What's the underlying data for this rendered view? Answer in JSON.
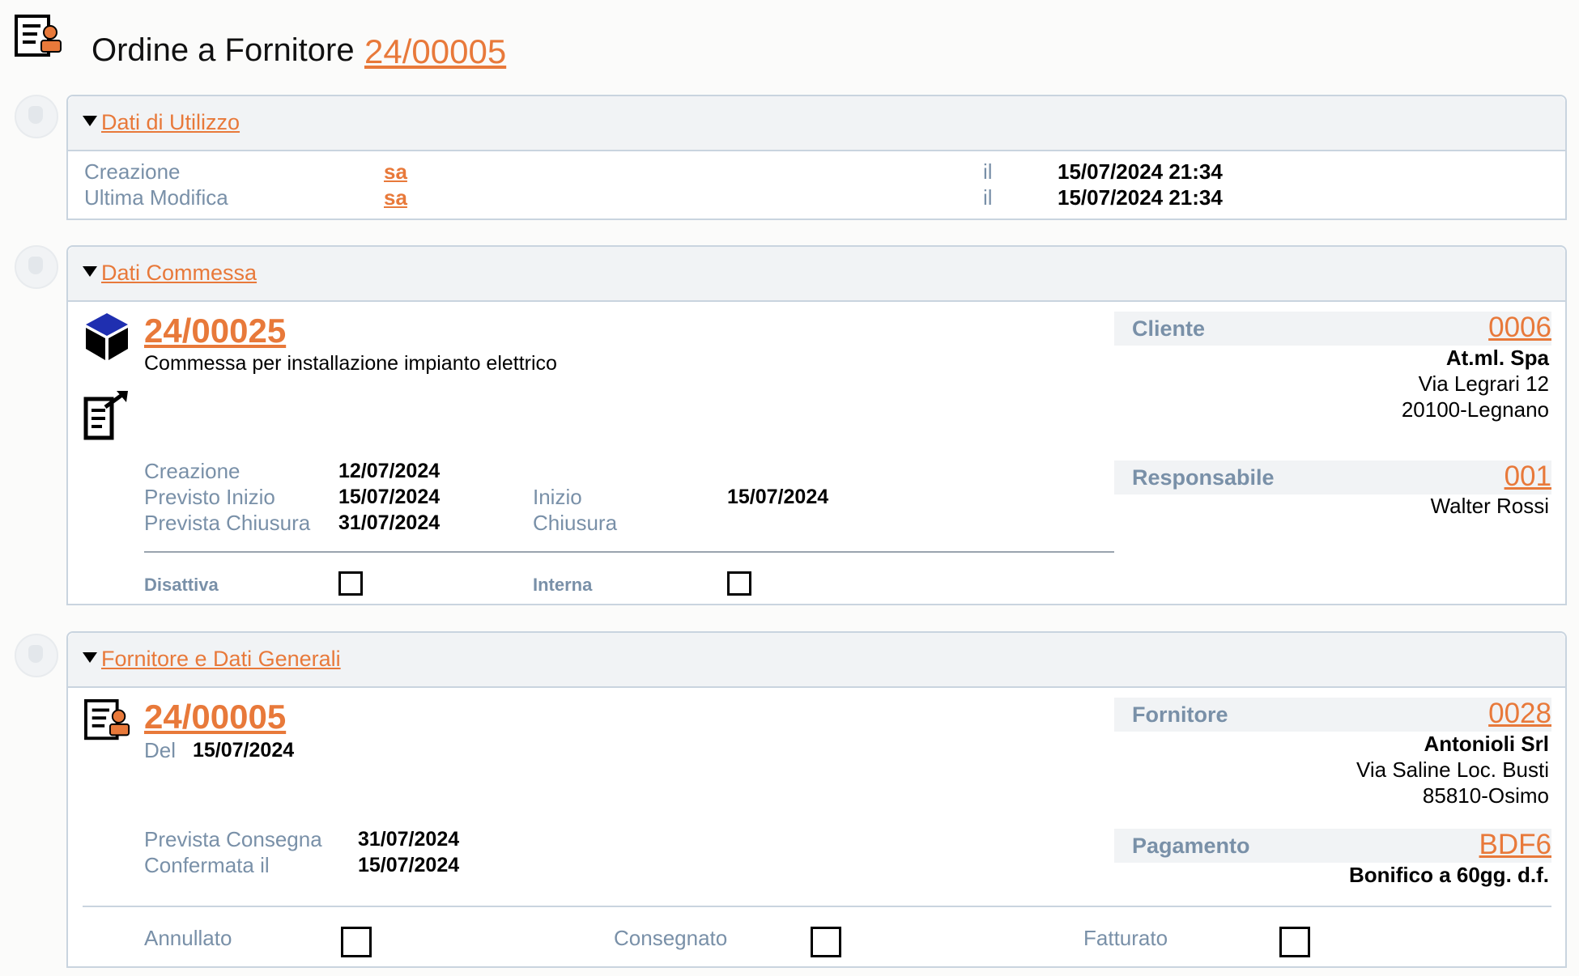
{
  "header": {
    "title": "Ordine a Fornitore",
    "order_number": "24/00005"
  },
  "usage": {
    "title": "Dati di Utilizzo",
    "created_label": "Creazione",
    "created_by": "sa",
    "created_at_label": "il",
    "created_at": "15/07/2024 21:34",
    "modified_label": "Ultima Modifica",
    "modified_by": "sa",
    "modified_at_label": "il",
    "modified_at": "15/07/2024 21:34"
  },
  "job": {
    "title": "Dati Commessa",
    "code": "24/00025",
    "description": "Commessa per installazione impianto elettrico",
    "created_label": "Creazione",
    "created": "12/07/2024",
    "planned_start_label": "Previsto Inizio",
    "planned_start": "15/07/2024",
    "planned_close_label": "Prevista Chiusura",
    "planned_close": "31/07/2024",
    "start_label": "Inizio",
    "start": "15/07/2024",
    "close_label": "Chiusura",
    "close": "",
    "disabled_label": "Disattiva",
    "internal_label": "Interna",
    "customer": {
      "label": "Cliente",
      "code": "0006",
      "name": "At.ml. Spa",
      "address": "Via Legrari 12",
      "city": "20100-Legnano"
    },
    "manager": {
      "label": "Responsabile",
      "code": "001",
      "name": "Walter Rossi"
    }
  },
  "supplier": {
    "title": "Fornitore e Dati Generali",
    "order_code": "24/00005",
    "date_label": "Del",
    "date": "15/07/2024",
    "planned_delivery_label": "Prevista Consegna",
    "planned_delivery": "31/07/2024",
    "confirmed_label": "Confermata il",
    "confirmed": "15/07/2024",
    "cancelled_label": "Annullato",
    "delivered_label": "Consegnato",
    "invoiced_label": "Fatturato",
    "vendor": {
      "label": "Fornitore",
      "code": "0028",
      "name": "Antonioli Srl",
      "address": "Via Saline Loc. Busti",
      "city": "85810-Osimo"
    },
    "payment": {
      "label": "Pagamento",
      "code": "BDF6",
      "description": "Bonifico a 60gg. d.f."
    }
  },
  "colors": {
    "accent": "#e8793a",
    "label": "#7990a8",
    "panel_header": "#f1f3f5",
    "border": "#c9d4df"
  },
  "icons": [
    "supplier-order-icon",
    "job-cube-icon",
    "edit-document-icon",
    "collapse-triangle-icon"
  ]
}
